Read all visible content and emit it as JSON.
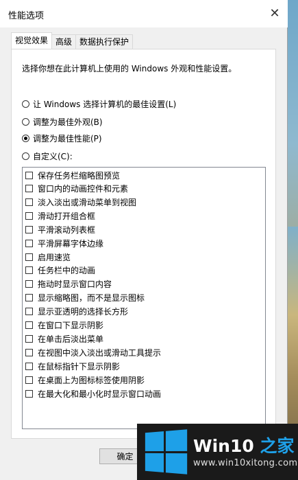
{
  "window": {
    "title": "性能选项",
    "close_glyph": "✕"
  },
  "tabs": [
    {
      "label": "视觉效果",
      "active": true
    },
    {
      "label": "高级",
      "active": false
    },
    {
      "label": "数据执行保护",
      "active": false
    }
  ],
  "panel": {
    "description": "选择你想在此计算机上使用的 Windows 外观和性能设置。",
    "radios": [
      {
        "label": "让 Windows 选择计算机的最佳设置(L)",
        "checked": false
      },
      {
        "label": "调整为最佳外观(B)",
        "checked": false
      },
      {
        "label": "调整为最佳性能(P)",
        "checked": true
      },
      {
        "label": "自定义(C):",
        "checked": false
      }
    ],
    "options": [
      {
        "label": "保存任务栏缩略图预览",
        "checked": false
      },
      {
        "label": "窗口内的动画控件和元素",
        "checked": false
      },
      {
        "label": "淡入淡出或滑动菜单到视图",
        "checked": false
      },
      {
        "label": "滑动打开组合框",
        "checked": false
      },
      {
        "label": "平滑滚动列表框",
        "checked": false
      },
      {
        "label": "平滑屏幕字体边缘",
        "checked": false
      },
      {
        "label": "启用速览",
        "checked": false
      },
      {
        "label": "任务栏中的动画",
        "checked": false
      },
      {
        "label": "拖动时显示窗口内容",
        "checked": false
      },
      {
        "label": "显示缩略图，而不是显示图标",
        "checked": false
      },
      {
        "label": "显示亚透明的选择长方形",
        "checked": false
      },
      {
        "label": "在窗口下显示阴影",
        "checked": false
      },
      {
        "label": "在单击后淡出菜单",
        "checked": false
      },
      {
        "label": "在视图中淡入淡出或滑动工具提示",
        "checked": false
      },
      {
        "label": "在鼠标指针下显示阴影",
        "checked": false
      },
      {
        "label": "在桌面上为图标标签使用阴影",
        "checked": false
      },
      {
        "label": "在最大化和最小化时显示窗口动画",
        "checked": false
      }
    ]
  },
  "buttons": {
    "ok": "确定"
  },
  "watermark": {
    "brand_prefix": "Win10",
    "brand_suffix": " 之家",
    "url": "www.win10xitong.com",
    "logo_icon": "windows-logo-icon",
    "accent_color": "#1ea0e8"
  }
}
